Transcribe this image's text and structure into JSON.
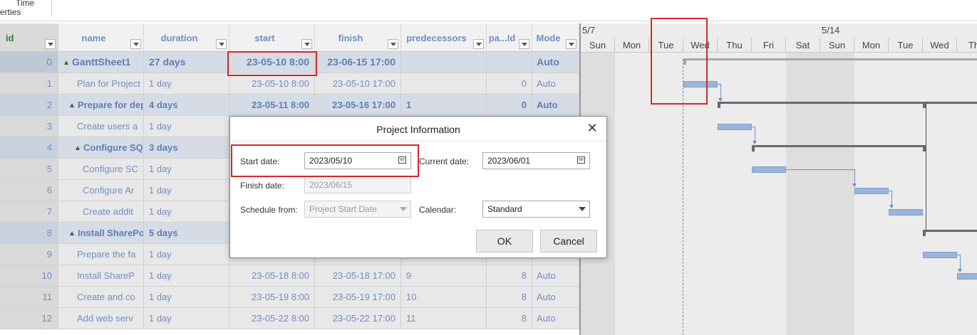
{
  "ribbon": {
    "line1": "Time",
    "line2": "erties"
  },
  "columns": [
    {
      "key": "id",
      "label": "id"
    },
    {
      "key": "name",
      "label": "name"
    },
    {
      "key": "duration",
      "label": "duration"
    },
    {
      "key": "start",
      "label": "start"
    },
    {
      "key": "finish",
      "label": "finish"
    },
    {
      "key": "predecessors",
      "label": "predecessors"
    },
    {
      "key": "parentId",
      "label": "pa...Id"
    },
    {
      "key": "mode",
      "label": "Mode"
    }
  ],
  "rows": [
    {
      "id": "0",
      "name": "GanttSheet1",
      "duration": "27 days",
      "start": "23-05-10 8:00",
      "finish": "23-06-15 17:00",
      "predecessors": "",
      "parentId": "",
      "mode": "Auto"
    },
    {
      "id": "1",
      "name": "Plan for Project",
      "duration": "1 day",
      "start": "23-05-10 8:00",
      "finish": "23-05-10 17:00",
      "predecessors": "",
      "parentId": "0",
      "mode": "Auto"
    },
    {
      "id": "2",
      "name": "Prepare for dep",
      "duration": "4 days",
      "start": "23-05-11 8:00",
      "finish": "23-05-16 17:00",
      "predecessors": "1",
      "parentId": "0",
      "mode": "Auto"
    },
    {
      "id": "3",
      "name": "Create users a",
      "duration": "1 day",
      "start": "",
      "finish": "",
      "predecessors": "",
      "parentId": "",
      "mode": ""
    },
    {
      "id": "4",
      "name": "Configure SQ",
      "duration": "3 days",
      "start": "",
      "finish": "",
      "predecessors": "",
      "parentId": "",
      "mode": ""
    },
    {
      "id": "5",
      "name": "Configure SC",
      "duration": "1 day",
      "start": "",
      "finish": "",
      "predecessors": "",
      "parentId": "",
      "mode": ""
    },
    {
      "id": "6",
      "name": "Configure Ar",
      "duration": "1 day",
      "start": "",
      "finish": "",
      "predecessors": "",
      "parentId": "",
      "mode": ""
    },
    {
      "id": "7",
      "name": "Create addit",
      "duration": "1 day",
      "start": "",
      "finish": "",
      "predecessors": "",
      "parentId": "",
      "mode": ""
    },
    {
      "id": "8",
      "name": "Install SharePo",
      "duration": "5 days",
      "start": "",
      "finish": "",
      "predecessors": "",
      "parentId": "",
      "mode": ""
    },
    {
      "id": "9",
      "name": "Prepare the fa",
      "duration": "1 day",
      "start": "",
      "finish": "",
      "predecessors": "",
      "parentId": "",
      "mode": ""
    },
    {
      "id": "10",
      "name": "Install ShareP",
      "duration": "1 day",
      "start": "23-05-18 8:00",
      "finish": "23-05-18 17:00",
      "predecessors": "9",
      "parentId": "8",
      "mode": "Auto"
    },
    {
      "id": "11",
      "name": "Create and co",
      "duration": "1 day",
      "start": "23-05-19 8:00",
      "finish": "23-05-19 17:00",
      "predecessors": "10",
      "parentId": "8",
      "mode": "Auto"
    },
    {
      "id": "12",
      "name": "Add web serv",
      "duration": "1 day",
      "start": "23-05-22 8:00",
      "finish": "23-05-22 17:00",
      "predecessors": "11",
      "parentId": "8",
      "mode": "Auto"
    }
  ],
  "gantt": {
    "weeks": [
      "5/7",
      "5/14"
    ],
    "days": [
      "Sun",
      "Mon",
      "Tue",
      "Wed",
      "Thu",
      "Fri",
      "Sat",
      "Sun",
      "Mon",
      "Tue",
      "Wed",
      "Th"
    ]
  },
  "dialog": {
    "title": "Project Information",
    "start_date_label": "Start date:",
    "start_date_value": "2023/05/10",
    "current_date_label": "Current date:",
    "current_date_value": "2023/06/01",
    "finish_date_label": "Finish date:",
    "finish_date_value": "2023/06/15",
    "schedule_from_label": "Schedule from:",
    "schedule_from_value": "Project Start Date",
    "calendar_label": "Calendar:",
    "calendar_value": "Standard",
    "ok_label": "OK",
    "cancel_label": "Cancel"
  }
}
